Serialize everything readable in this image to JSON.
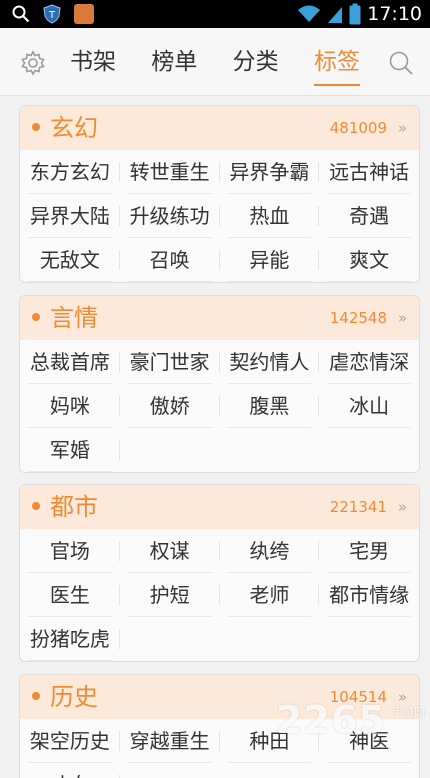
{
  "status_bar": {
    "time": "17:10"
  },
  "header": {
    "tabs": [
      {
        "label": "书架"
      },
      {
        "label": "榜单"
      },
      {
        "label": "分类"
      },
      {
        "label": "标签"
      }
    ],
    "active_tab": 3
  },
  "categories": [
    {
      "title": "玄幻",
      "count": "481009",
      "more": "»",
      "tags": [
        "东方玄幻",
        "转世重生",
        "异界争霸",
        "远古神话",
        "异界大陆",
        "升级练功",
        "热血",
        "奇遇",
        "无敌文",
        "召唤",
        "异能",
        "爽文"
      ]
    },
    {
      "title": "言情",
      "count": "142548",
      "more": "»",
      "tags": [
        "总裁首席",
        "豪门世家",
        "契约情人",
        "虐恋情深",
        "妈咪",
        "傲娇",
        "腹黑",
        "冰山",
        "军婚"
      ]
    },
    {
      "title": "都市",
      "count": "221341",
      "more": "»",
      "tags": [
        "官场",
        "权谋",
        "纨绔",
        "宅男",
        "医生",
        "护短",
        "老师",
        "都市情缘",
        "扮猪吃虎"
      ]
    },
    {
      "title": "历史",
      "count": "104514",
      "more": "»",
      "tags": [
        "架空历史",
        "穿越重生",
        "种田",
        "神医",
        "才女"
      ]
    }
  ],
  "watermark": {
    "main": "2265",
    "sub": "手游网"
  },
  "colors": {
    "accent": "#f08a33",
    "card_head": "#fde9d9"
  },
  "icons": [
    "search-icon",
    "shield-icon",
    "app-icon",
    "wifi-icon",
    "signal-icon",
    "battery-icon",
    "gear-icon"
  ]
}
